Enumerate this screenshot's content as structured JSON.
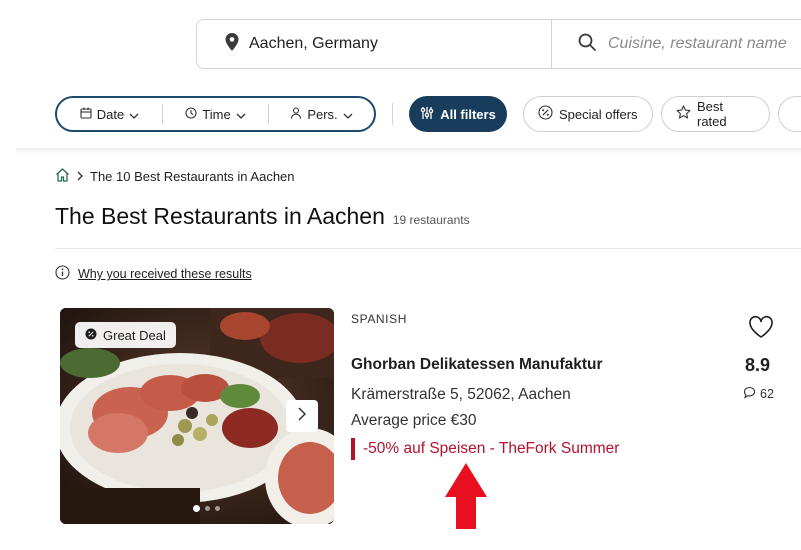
{
  "search": {
    "location": "Aachen, Germany",
    "query_placeholder": "Cuisine, restaurant name"
  },
  "filters": {
    "date_label": "Date",
    "time_label": "Time",
    "persons_label": "Pers.",
    "all_filters_label": "All filters",
    "special_offers_label": "Special offers",
    "best_rated_label": "Best rated"
  },
  "breadcrumb": {
    "current": "The 10 Best Restaurants in Aachen"
  },
  "page": {
    "title": "The Best Restaurants in Aachen",
    "count": "19 restaurants",
    "why_link": "Why you received these results"
  },
  "restaurant": {
    "badge": "Great Deal",
    "cuisine": "SPANISH",
    "name": "Ghorban Delikatessen Manufaktur",
    "address": "Krämerstraße 5, 52062, Aachen",
    "average_price": "Average price €30",
    "promo": "-50% auf Speisen - TheFork Summer",
    "rating": "8.9",
    "review_count": "62",
    "photo_index": 1,
    "photo_total": 3
  },
  "colors": {
    "brand_dark": "#183d5c",
    "outline_blue": "#1c4b6e",
    "promo_red": "#b3122d",
    "annotation_arrow": "#e8101e"
  },
  "icons": {
    "location": "map-pin-icon",
    "search": "magnifier-icon",
    "date": "calendar-icon",
    "time": "clock-icon",
    "persons": "person-icon",
    "all_filters": "sliders-icon",
    "special_offers": "percent-badge-icon",
    "best_rated": "star-icon",
    "home": "home-icon",
    "info": "info-icon",
    "favorite": "heart-icon",
    "reviews": "speech-bubble-icon"
  }
}
